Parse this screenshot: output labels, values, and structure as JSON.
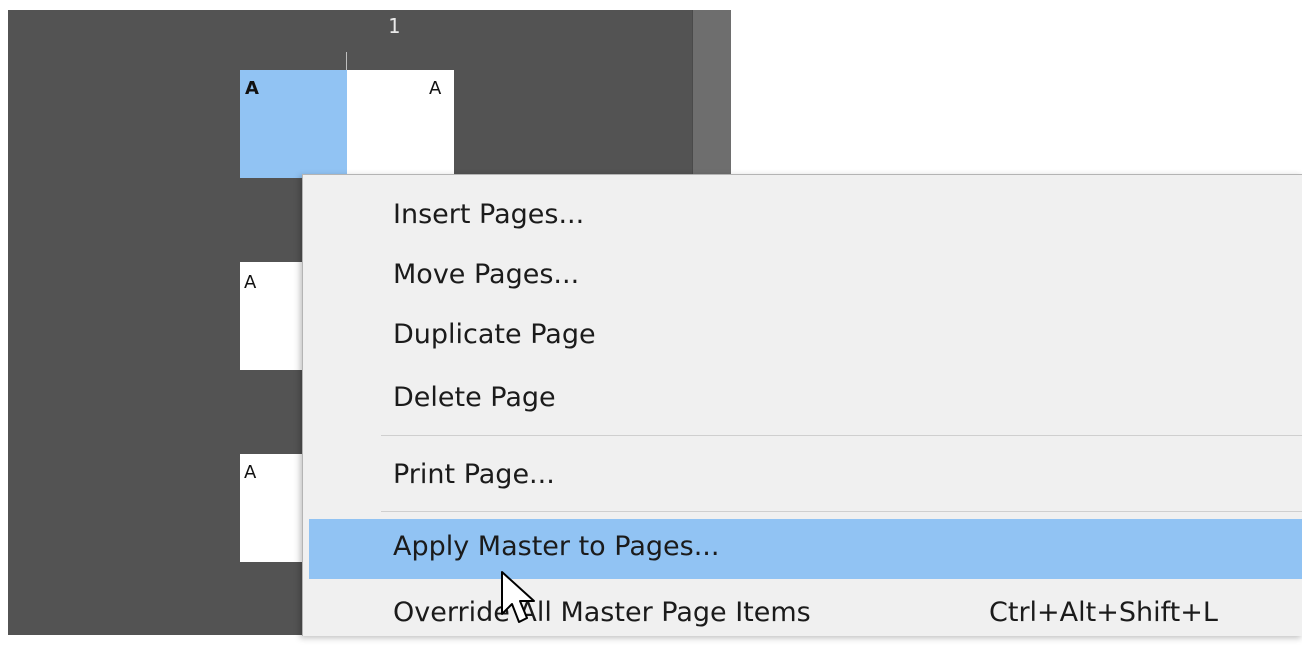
{
  "panel": {
    "spread_page_number": "1",
    "spread": {
      "left_master_letter": "A",
      "right_master_letter": "A"
    },
    "pages": [
      {
        "master_letter": "A"
      },
      {
        "master_letter": "A"
      }
    ],
    "colors": {
      "panel_bg": "#535353",
      "selection_blue": "#91c3f3",
      "menu_bg": "#f0f0f0"
    }
  },
  "context_menu": {
    "items": [
      {
        "label": "Insert Pages..."
      },
      {
        "label": "Move Pages..."
      },
      {
        "label": "Duplicate Page"
      },
      {
        "label": "Delete Page"
      },
      {
        "label": "Print Page..."
      },
      {
        "label": "Apply Master to Pages...",
        "highlighted": true
      },
      {
        "label": "Override All Master Page Items",
        "shortcut": "Ctrl+Alt+Shift+L"
      }
    ]
  },
  "cursor": {
    "icon": "arrow-pointer-icon"
  }
}
